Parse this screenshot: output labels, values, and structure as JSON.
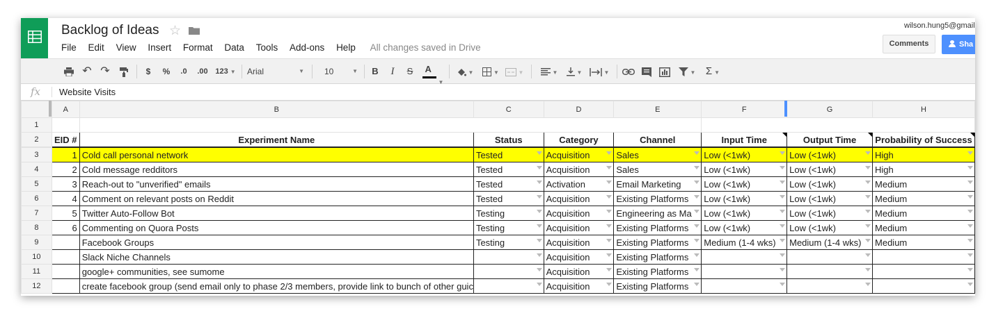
{
  "app": {
    "title": "Backlog of Ideas",
    "save_status": "All changes saved in Drive",
    "user_email": "wilson.hung5@gmail",
    "comments_label": "Comments",
    "share_label": "Sha",
    "accent": "#4d90fe",
    "brand": "#0f9d58"
  },
  "menu": [
    "File",
    "Edit",
    "View",
    "Insert",
    "Format",
    "Data",
    "Tools",
    "Add-ons",
    "Help"
  ],
  "toolbar": {
    "currency": "$",
    "percent": "%",
    "decrease_decimals": ".0",
    "increase_decimals": ".00",
    "more_formats": "123",
    "font": "Arial",
    "font_size": "10",
    "bold": "B",
    "italic": "I",
    "strike": "S",
    "text_color": "A",
    "functions": "Σ"
  },
  "formula_bar": {
    "fx": "fx",
    "value": "Website Visits"
  },
  "columns": [
    "A",
    "B",
    "C",
    "D",
    "E",
    "F",
    "G",
    "H"
  ],
  "header_row": [
    "EID #",
    "Experiment Name",
    "Status",
    "Category",
    "Channel",
    "Input Time",
    "Output Time",
    "Probability of Success"
  ],
  "rows": [
    {
      "n": "3",
      "eid": "1",
      "name": "Cold call personal network",
      "status": "Tested",
      "category": "Acquisition",
      "channel": "Sales",
      "input": "Low (<1wk)",
      "output": "Low (<1wk)",
      "prob": "High"
    },
    {
      "n": "4",
      "eid": "2",
      "name": "Cold message redditors",
      "status": "Tested",
      "category": "Acquisition",
      "channel": "Sales",
      "input": "Low (<1wk)",
      "output": "Low (<1wk)",
      "prob": "High"
    },
    {
      "n": "5",
      "eid": "3",
      "name": "Reach-out to \"unverified\" emails",
      "status": "Tested",
      "category": "Activation",
      "channel": "Email Marketing",
      "input": "Low (<1wk)",
      "output": "Low (<1wk)",
      "prob": "Medium"
    },
    {
      "n": "6",
      "eid": "4",
      "name": "Comment on relevant posts on Reddit",
      "status": "Tested",
      "category": "Acquisition",
      "channel": "Existing Platforms",
      "input": "Low (<1wk)",
      "output": "Low (<1wk)",
      "prob": "Medium"
    },
    {
      "n": "7",
      "eid": "5",
      "name": "Twitter Auto-Follow Bot",
      "status": "Testing",
      "category": "Acquisition",
      "channel": "Engineering as Ma",
      "input": "Low (<1wk)",
      "output": "Low (<1wk)",
      "prob": "Medium"
    },
    {
      "n": "8",
      "eid": "6",
      "name": "Commenting on Quora Posts",
      "status": "Testing",
      "category": "Acquisition",
      "channel": "Existing Platforms",
      "input": "Low (<1wk)",
      "output": "Low (<1wk)",
      "prob": "Medium"
    },
    {
      "n": "9",
      "eid": "",
      "name": "Facebook Groups",
      "status": "Testing",
      "category": "Acquisition",
      "channel": "Existing Platforms",
      "input": "Medium (1-4 wks)",
      "output": "Medium (1-4 wks)",
      "prob": "Medium"
    },
    {
      "n": "10",
      "eid": "",
      "name": "Slack Niche Channels",
      "status": "",
      "category": "Acquisition",
      "channel": "Existing Platforms",
      "input": "",
      "output": "",
      "prob": ""
    },
    {
      "n": "11",
      "eid": "",
      "name": "google+ communities, see sumome",
      "status": "",
      "category": "Acquisition",
      "channel": "Existing Platforms",
      "input": "",
      "output": "",
      "prob": ""
    },
    {
      "n": "12",
      "eid": "",
      "name": "create facebook group (send email only to phase 2/3 members, provide link to bunch of other guic",
      "status": "",
      "category": "Acquisition",
      "channel": "Existing Platforms",
      "input": "",
      "output": "",
      "prob": ""
    }
  ],
  "row_numbers_top": [
    "1",
    "2"
  ],
  "highlight_color": "#ffff00"
}
